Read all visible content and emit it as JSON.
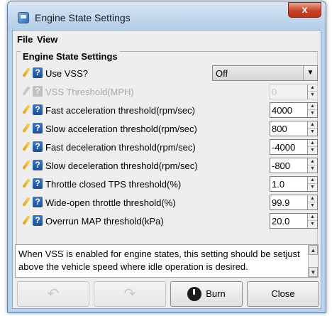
{
  "window": {
    "title": "Engine State Settings",
    "close_label": "x"
  },
  "menu": {
    "file": "File",
    "view": "View"
  },
  "group": {
    "title": "Engine State Settings"
  },
  "settings": [
    {
      "label": "Use VSS?",
      "value": "Off",
      "control": "combo",
      "enabled": true
    },
    {
      "label": "VSS Threshold(MPH)",
      "value": "0",
      "control": "spinner",
      "enabled": false
    },
    {
      "label": "Fast acceleration threshold(rpm/sec)",
      "value": "4000",
      "control": "spinner",
      "enabled": true
    },
    {
      "label": "Slow acceleration threshold(rpm/sec)",
      "value": "800",
      "control": "spinner",
      "enabled": true
    },
    {
      "label": "Fast deceleration threshold(rpm/sec)",
      "value": "-4000",
      "control": "spinner",
      "enabled": true
    },
    {
      "label": "Slow deceleration threshold(rpm/sec)",
      "value": "-800",
      "control": "spinner",
      "enabled": true
    },
    {
      "label": "Throttle closed TPS threshold(%)",
      "value": "1.0",
      "control": "spinner",
      "enabled": true
    },
    {
      "label": "Wide-open throttle threshold(%)",
      "value": "99.9",
      "control": "spinner",
      "enabled": true
    },
    {
      "label": "Overrun MAP threshold(kPa)",
      "value": "20.0",
      "control": "spinner",
      "enabled": true
    }
  ],
  "help_text": "When VSS is enabled for engine states, this setting should be setjust above the vehicle speed where idle operation is desired.",
  "buttons": {
    "burn": "Burn",
    "close": "Close"
  },
  "colors": {
    "titlebar": "#b4cde6",
    "close_button": "#c7442a",
    "help_icon": "#1d4f97"
  }
}
